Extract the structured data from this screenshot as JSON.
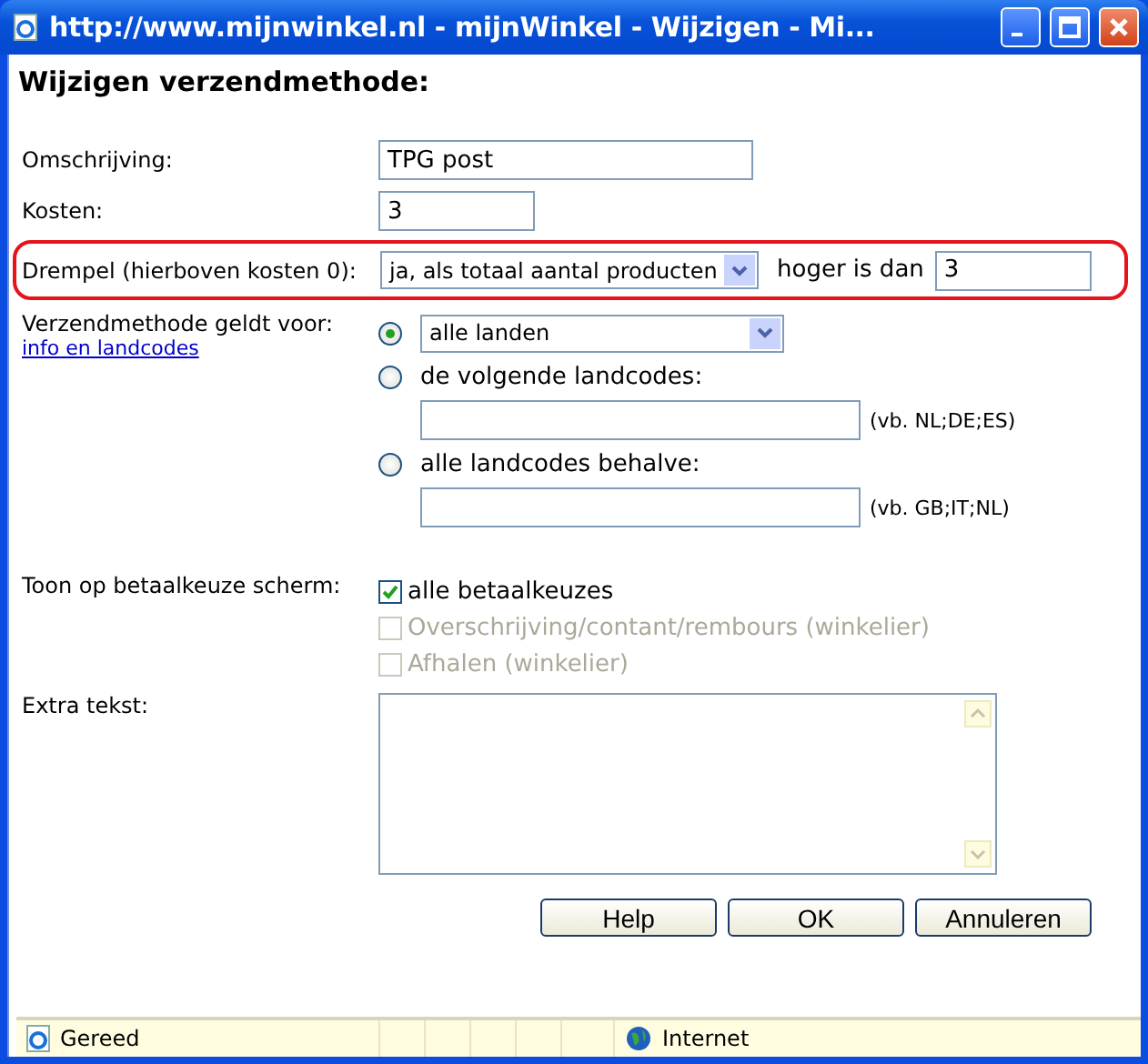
{
  "window": {
    "title": "http://www.mijnwinkel.nl - mijnWinkel - Wijzigen - Mi..."
  },
  "heading": "Wijzigen verzendmethode:",
  "description": {
    "label": "Omschrijving:",
    "value": "TPG post"
  },
  "cost": {
    "label": "Kosten:",
    "value": "3"
  },
  "threshold": {
    "label": "Drempel (hierboven kosten 0):",
    "choice": "ja, als totaal aantal producten",
    "suffix": "hoger is dan",
    "value": "3",
    "highlighted": true
  },
  "countries": {
    "label": "Verzendmethode geldt voor:",
    "link": "info en landcodes",
    "options": [
      {
        "kind": "select",
        "selected": true,
        "value": "alle landen"
      },
      {
        "kind": "codes",
        "selected": false,
        "label": "de volgende landcodes:",
        "example": "(vb. NL;DE;ES)"
      },
      {
        "kind": "codes",
        "selected": false,
        "label": "alle landcodes behalve:",
        "example": "(vb. GB;IT;NL)"
      }
    ]
  },
  "payment": {
    "label": "Toon op betaalkeuze scherm:",
    "options": [
      {
        "label": "alle betaalkeuzes",
        "checked": true,
        "disabled": false
      },
      {
        "label": "Overschrijving/contant/rembours (winkelier)",
        "checked": false,
        "disabled": true
      },
      {
        "label": "Afhalen (winkelier)",
        "checked": false,
        "disabled": true
      }
    ]
  },
  "extra_text": {
    "label": "Extra tekst:"
  },
  "buttons": [
    "Help",
    "OK",
    "Annuleren"
  ],
  "status_bar": {
    "text": "Gereed",
    "zone": "Internet"
  }
}
